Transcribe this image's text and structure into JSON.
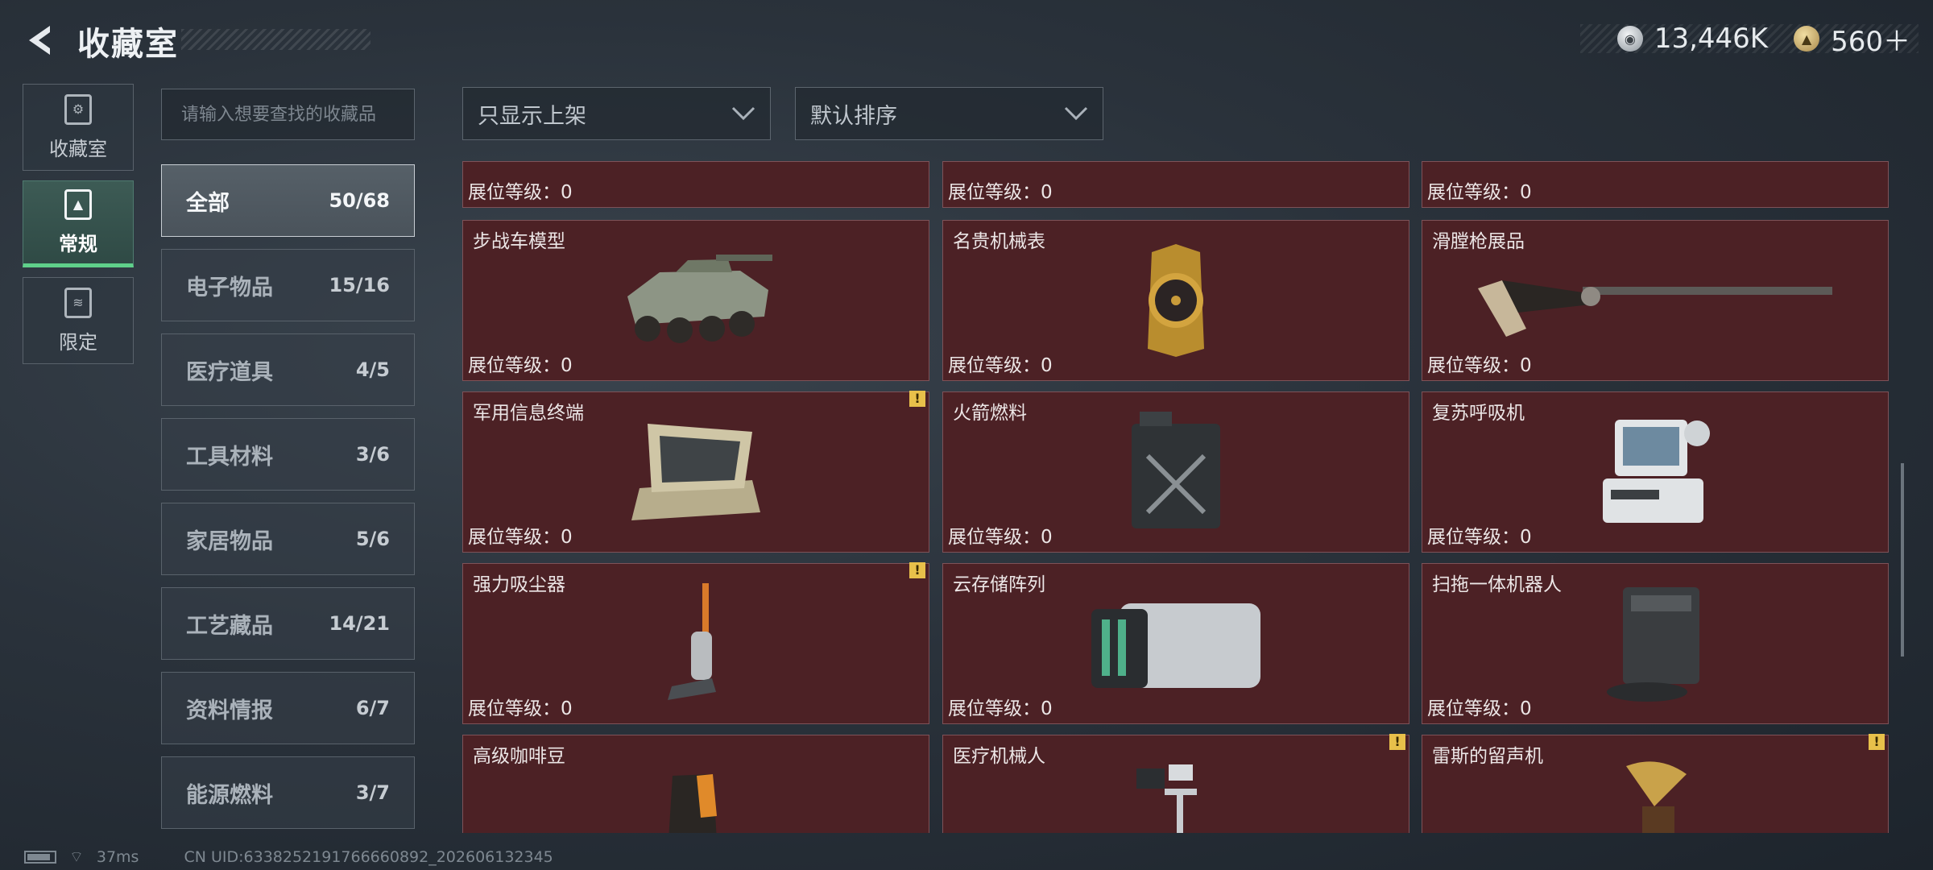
{
  "header": {
    "title": "收藏室",
    "currency": [
      {
        "icon": "silver-coin-icon",
        "value": "13,446K"
      },
      {
        "icon": "gold-coin-icon",
        "value": "560＋"
      }
    ]
  },
  "left_nav": [
    {
      "label": "收藏室",
      "icon": "collection-room-icon",
      "active": false
    },
    {
      "label": "常规",
      "icon": "regular-icon",
      "active": true
    },
    {
      "label": "限定",
      "icon": "limited-icon",
      "active": false
    }
  ],
  "search": {
    "placeholder": "请输入想要查找的收藏品"
  },
  "filters": {
    "display": "只显示上架",
    "sort": "默认排序"
  },
  "categories": [
    {
      "label": "全部",
      "count": "50/68",
      "active": true
    },
    {
      "label": "电子物品",
      "count": "15/16"
    },
    {
      "label": "医疗道具",
      "count": "4/5"
    },
    {
      "label": "工具材料",
      "count": "3/6"
    },
    {
      "label": "家居物品",
      "count": "5/6"
    },
    {
      "label": "工艺藏品",
      "count": "14/21"
    },
    {
      "label": "资料情报",
      "count": "6/7"
    },
    {
      "label": "能源燃料",
      "count": "3/7"
    }
  ],
  "level_label": "展位等级：0",
  "items": [
    {
      "name": "",
      "level": "展位等级：0",
      "warning": false
    },
    {
      "name": "",
      "level": "展位等级：0",
      "warning": false
    },
    {
      "name": "",
      "level": "展位等级：0",
      "warning": false
    },
    {
      "name": "步战车模型",
      "level": "展位等级：0",
      "warning": false,
      "icon": "ifv-model"
    },
    {
      "name": "名贵机械表",
      "level": "展位等级：0",
      "warning": false,
      "icon": "watch"
    },
    {
      "name": "滑膛枪展品",
      "level": "展位等级：0",
      "warning": false,
      "icon": "musket"
    },
    {
      "name": "军用信息终端",
      "level": "展位等级：0",
      "warning": true,
      "icon": "terminal"
    },
    {
      "name": "火箭燃料",
      "level": "展位等级：0",
      "warning": false,
      "icon": "jerrycan"
    },
    {
      "name": "复苏呼吸机",
      "level": "展位等级：0",
      "warning": false,
      "icon": "ventilator"
    },
    {
      "name": "强力吸尘器",
      "level": "展位等级：0",
      "warning": true,
      "icon": "vacuum"
    },
    {
      "name": "云存储阵列",
      "level": "展位等级：0",
      "warning": false,
      "icon": "storage-array"
    },
    {
      "name": "扫拖一体机器人",
      "level": "展位等级：0",
      "warning": false,
      "icon": "robot-vacuum"
    },
    {
      "name": "高级咖啡豆",
      "level": "",
      "warning": false,
      "icon": "coffee-bag"
    },
    {
      "name": "医疗机械人",
      "level": "",
      "warning": true,
      "icon": "medical-robot"
    },
    {
      "name": "雷斯的留声机",
      "level": "",
      "warning": true,
      "icon": "gramophone"
    }
  ],
  "footer": {
    "ping": "37ms",
    "uid": "CN UID:6338252191766660892_202606132345"
  },
  "colors": {
    "card_bg": "#4c2125",
    "accent_green": "#5fd08a",
    "warning": "#e8c04a"
  }
}
